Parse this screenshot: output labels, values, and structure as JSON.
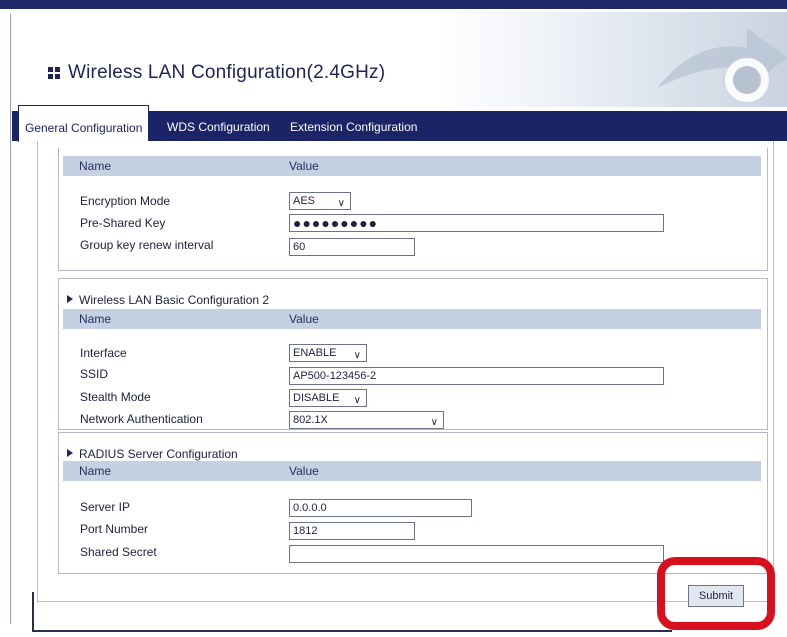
{
  "header": {
    "title": "Wireless LAN Configuration(2.4GHz)"
  },
  "tabs": [
    {
      "label": "General Configuration"
    },
    {
      "label": "WDS Configuration"
    },
    {
      "label": "Extension Configuration"
    }
  ],
  "table_columns": {
    "name": "Name",
    "value": "Value"
  },
  "security": {
    "encryption_mode": {
      "label": "Encryption Mode",
      "value": "AES"
    },
    "pre_shared_key": {
      "label": "Pre-Shared Key",
      "value": "●●●●●●●●●"
    },
    "group_key_interval": {
      "label": "Group key renew interval",
      "value": "60"
    }
  },
  "basic2": {
    "title": "Wireless LAN Basic Configuration 2",
    "interface": {
      "label": "Interface",
      "value": "ENABLE"
    },
    "ssid": {
      "label": "SSID",
      "value": "AP500-123456-2"
    },
    "stealth": {
      "label": "Stealth Mode",
      "value": "DISABLE"
    },
    "auth": {
      "label": "Network Authentication",
      "value": "802.1X"
    }
  },
  "radius": {
    "title": "RADIUS Server Configuration",
    "server_ip": {
      "label": "Server IP",
      "value": "0.0.0.0"
    },
    "port": {
      "label": "Port Number",
      "value": "1812"
    },
    "secret": {
      "label": "Shared Secret",
      "value": ""
    }
  },
  "submit_label": "Submit",
  "colors": {
    "navy": "#1a2466",
    "highlight": "#d80f1d",
    "header_band": "#c6d0e3"
  },
  "icons": [
    "menu-squares-icon",
    "triangle-right-icon",
    "chevron-down-icon"
  ]
}
